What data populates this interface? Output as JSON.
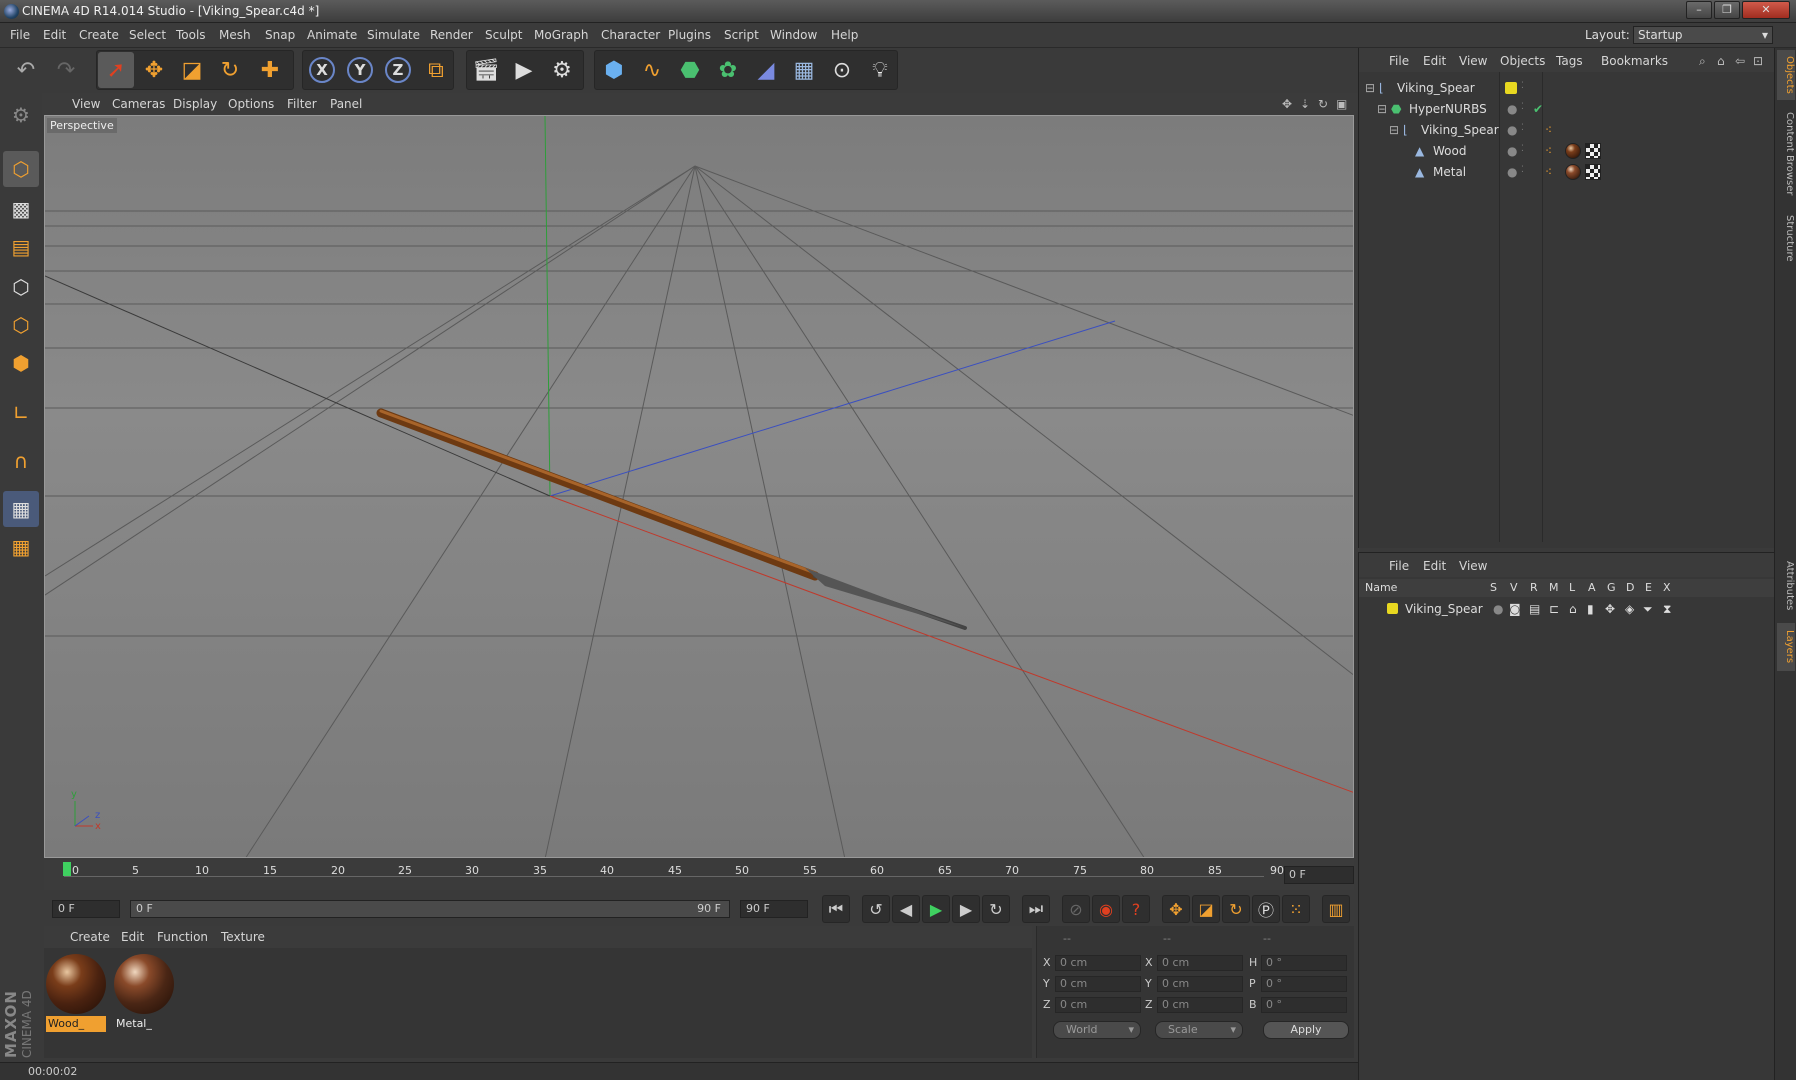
{
  "window": {
    "title": "CINEMA 4D R14.014 Studio - [Viking_Spear.c4d *]",
    "minimize": "–",
    "maximize": "❐",
    "close": "✕"
  },
  "menubar": {
    "items": [
      "File",
      "Edit",
      "Create",
      "Select",
      "Tools",
      "Mesh",
      "Snap",
      "Animate",
      "Simulate",
      "Render",
      "Sculpt",
      "MoGraph",
      "Character",
      "Plugins",
      "Script",
      "Window",
      "Help"
    ],
    "layout_label": "Layout:",
    "layout_value": "Startup"
  },
  "toolbar": {
    "axis_x": "X",
    "axis_y": "Y",
    "axis_z": "Z"
  },
  "viewport": {
    "menu": [
      "View",
      "Cameras",
      "Display",
      "Options",
      "Filter",
      "Panel"
    ],
    "label": "Perspective",
    "axis_y": "y",
    "axis_z": "z",
    "axis_x": "x"
  },
  "timeline": {
    "ticks": [
      "0",
      "5",
      "10",
      "15",
      "20",
      "25",
      "30",
      "35",
      "40",
      "45",
      "50",
      "55",
      "60",
      "65",
      "70",
      "75",
      "80",
      "85",
      "90"
    ],
    "current_frame": "0 F"
  },
  "transport": {
    "start_field": "0 F",
    "range_start": "0 F",
    "range_end": "90 F",
    "end_field": "90 F"
  },
  "materials": {
    "menu": [
      "Create",
      "Edit",
      "Function",
      "Texture"
    ],
    "items": [
      {
        "label": "Wood_",
        "selected": true
      },
      {
        "label": "Metal_",
        "selected": false
      }
    ]
  },
  "coordinates": {
    "col_headers": [
      "--",
      "--",
      "--"
    ],
    "rows": [
      {
        "l1": "X",
        "v1": "0 cm",
        "l2": "X",
        "v2": "0 cm",
        "l3": "H",
        "v3": "0 °"
      },
      {
        "l1": "Y",
        "v1": "0 cm",
        "l2": "Y",
        "v2": "0 cm",
        "l3": "P",
        "v3": "0 °"
      },
      {
        "l1": "Z",
        "v1": "0 cm",
        "l2": "Z",
        "v2": "0 cm",
        "l3": "B",
        "v3": "0 °"
      }
    ],
    "mode1": "World",
    "mode2": "Scale",
    "apply": "Apply"
  },
  "status": {
    "time": "00:00:02"
  },
  "logo": {
    "line1": "MAXON",
    "line2": "CINEMA 4D"
  },
  "objects": {
    "menu": [
      "File",
      "Edit",
      "View",
      "Objects",
      "Tags",
      "Bookmarks"
    ],
    "tree": [
      {
        "name": "Viking_Spear"
      },
      {
        "name": "HyperNURBS"
      },
      {
        "name": "Viking_Spear"
      },
      {
        "name": "Wood"
      },
      {
        "name": "Metal"
      }
    ]
  },
  "layers": {
    "menu": [
      "File",
      "Edit",
      "View"
    ],
    "headers": [
      "Name",
      "S",
      "V",
      "R",
      "M",
      "L",
      "A",
      "G",
      "D",
      "E",
      "X"
    ],
    "rows": [
      {
        "name": "Viking_Spear"
      }
    ]
  },
  "right_tabs": [
    "Objects",
    "Content Browser",
    "Structure",
    "Attributes",
    "Layers"
  ],
  "colors": {
    "accent_orange": "#f0a030",
    "layer_yellow": "#e8d820",
    "x_axis": "#c0392b",
    "y_axis": "#2e9e3a",
    "z_axis": "#3a4fc0"
  }
}
